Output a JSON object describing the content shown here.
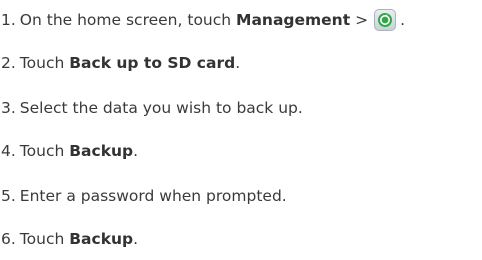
{
  "steps": [
    {
      "num": "1.",
      "pre": "On the home screen, touch",
      "bold": "Management",
      "sep": ">",
      "post": "."
    },
    {
      "num": "2.",
      "pre": "Touch",
      "bold": "Back up to SD card",
      "post": "."
    },
    {
      "num": "3.",
      "text": "Select the data you wish to back up."
    },
    {
      "num": "4.",
      "pre": "Touch",
      "bold": "Backup",
      "post": "."
    },
    {
      "num": "5.",
      "text": "Enter a password when prompted."
    },
    {
      "num": "6.",
      "pre": "Touch",
      "bold": "Backup",
      "post": "."
    }
  ],
  "icons": {
    "backup_app": "backup-app-icon"
  },
  "colors": {
    "text": "#3a3a3a",
    "icon_green": "#2fa84a"
  }
}
